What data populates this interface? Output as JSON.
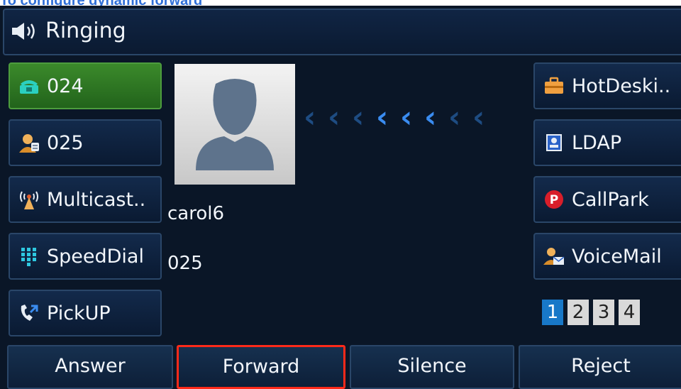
{
  "caption": "To configure dynamic forward",
  "status": {
    "text": "Ringing",
    "icon": "speaker-icon"
  },
  "line_keys_left": [
    {
      "label": "024",
      "icon": "phone-line-icon",
      "active": true
    },
    {
      "label": "025",
      "icon": "user-contact-icon",
      "active": false
    },
    {
      "label": "Multicast..",
      "icon": "antenna-icon",
      "active": false
    },
    {
      "label": "SpeedDial",
      "icon": "keypad-icon",
      "active": false
    },
    {
      "label": "PickUP",
      "icon": "pickup-phone-icon",
      "active": false
    }
  ],
  "line_keys_right": [
    {
      "label": "HotDeski..",
      "icon": "briefcase-icon"
    },
    {
      "label": "LDAP",
      "icon": "directory-icon"
    },
    {
      "label": "CallPark",
      "icon": "park-icon",
      "badge": "P"
    },
    {
      "label": "VoiceMail",
      "icon": "voicemail-user-icon"
    }
  ],
  "caller": {
    "name": "carol6",
    "number": "025"
  },
  "pages": [
    "1",
    "2",
    "3",
    "4"
  ],
  "current_page": "1",
  "softkeys": [
    "Answer",
    "Forward",
    "Silence",
    "Reject"
  ],
  "highlighted_softkey": "Forward",
  "colors": {
    "screen_bg": "#0a1627",
    "active_key": "#2f7a25",
    "chevron_bright": "#3a8cf0",
    "chevron_dim": "#1e4c82",
    "highlight": "#ff2a1a",
    "caption": "#2f6fd8"
  }
}
